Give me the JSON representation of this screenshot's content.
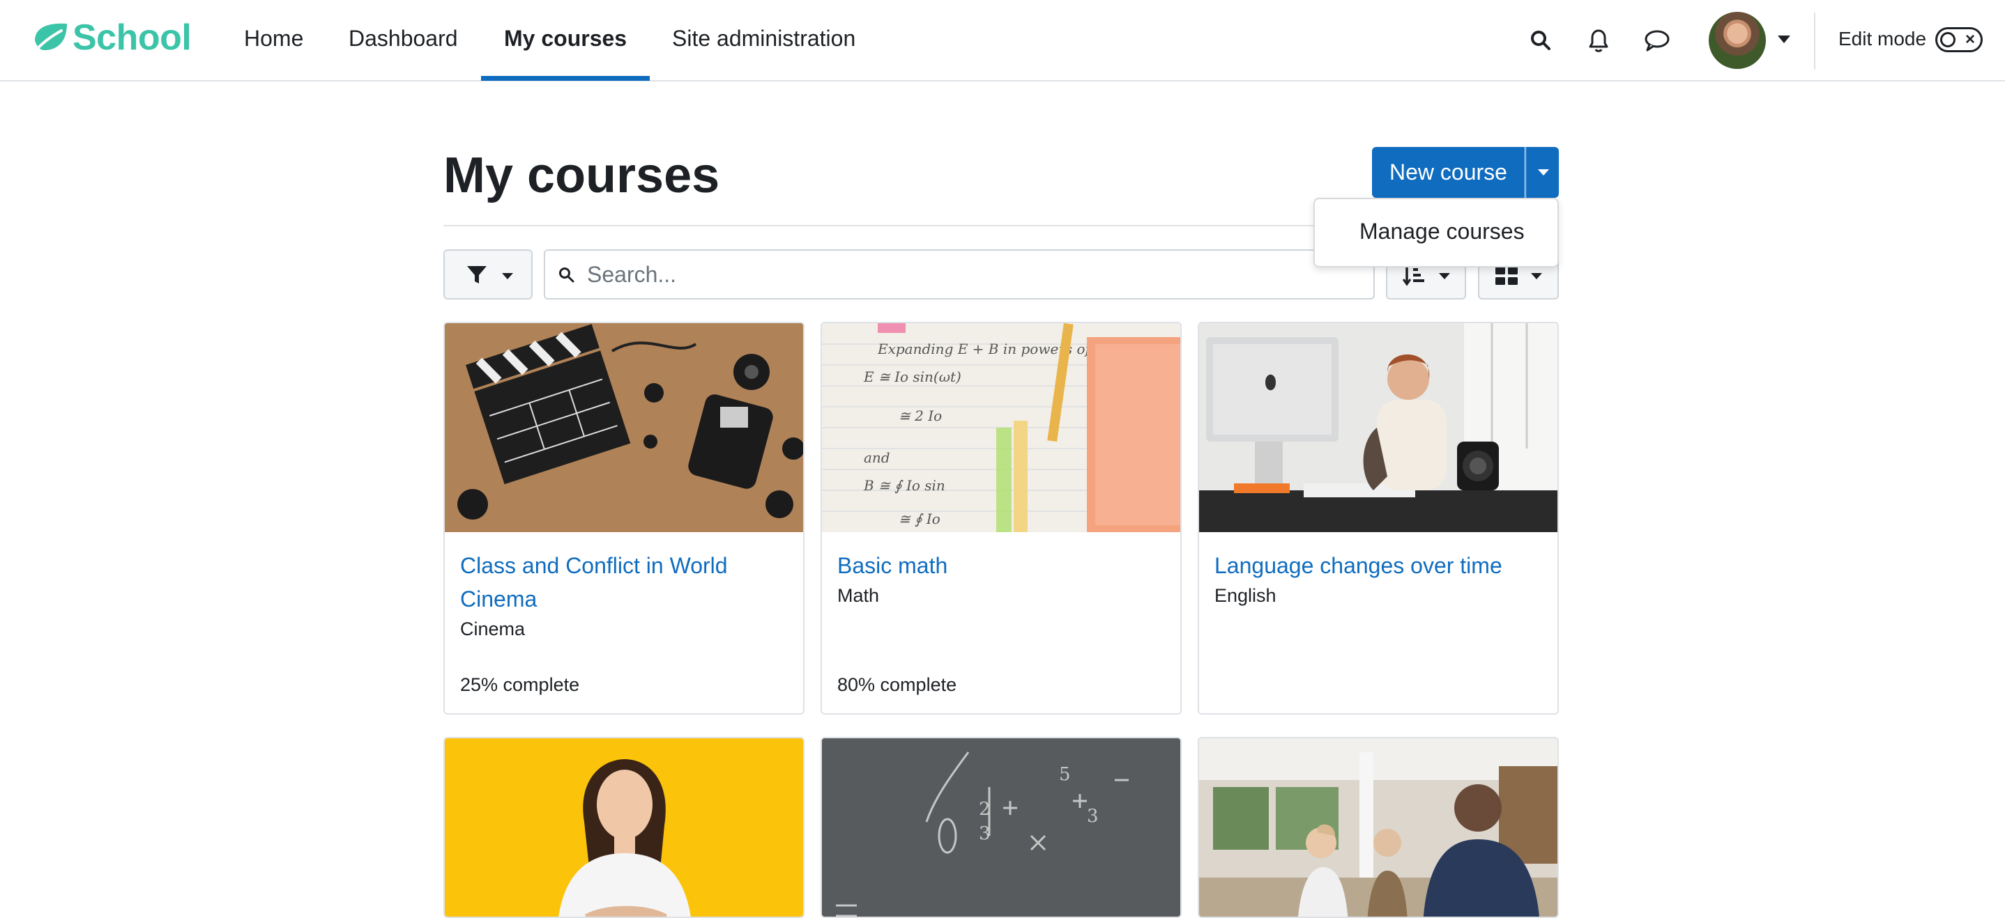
{
  "brand": {
    "name": "School"
  },
  "nav": {
    "items": [
      {
        "label": "Home"
      },
      {
        "label": "Dashboard"
      },
      {
        "label": "My courses"
      },
      {
        "label": "Site administration"
      }
    ],
    "active": "My courses",
    "icons": [
      "search-icon",
      "bell-icon",
      "chat-icon"
    ],
    "edit_mode_label": "Edit mode",
    "edit_mode_on": false
  },
  "page": {
    "title": "My courses",
    "new_course_label": "New course",
    "menu": [
      {
        "label": "Manage courses"
      }
    ]
  },
  "filters": {
    "search_placeholder": "Search..."
  },
  "courses": [
    {
      "title": "Class and Conflict in World Cinema",
      "category": "Cinema",
      "progress": "25% complete",
      "progress_value": 25
    },
    {
      "title": "Basic math",
      "category": "Math",
      "progress": "80% complete",
      "progress_value": 80
    },
    {
      "title": "Language changes over time",
      "category": "English",
      "progress": ""
    }
  ],
  "colors": {
    "brand": "#3bc4a8",
    "primary": "#0f6cbf",
    "text": "#1d2125",
    "border": "#dee2e6"
  }
}
